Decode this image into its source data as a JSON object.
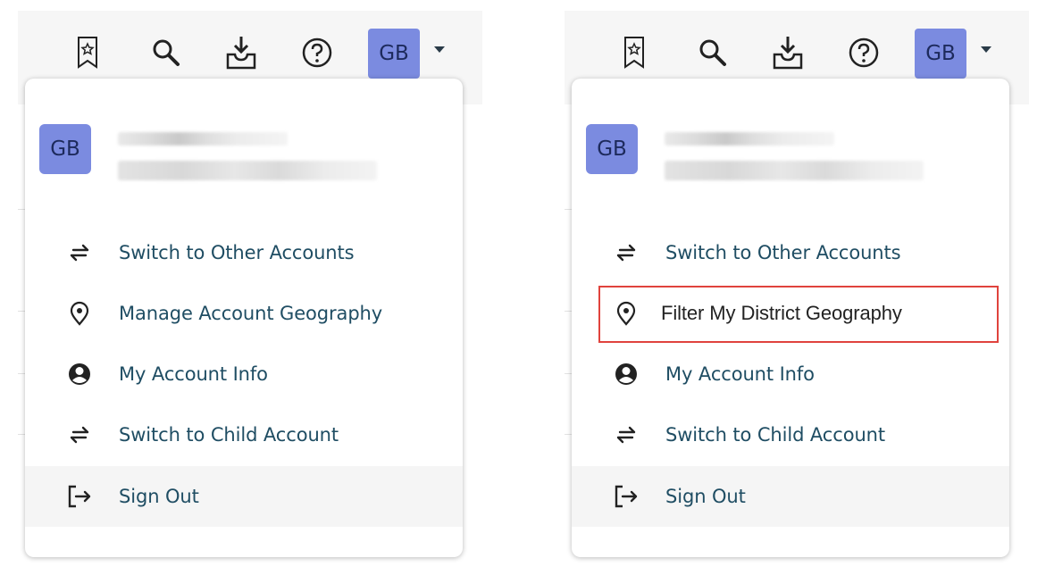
{
  "panels": [
    {
      "avatar_initials": "GB",
      "menu_avatar_initials": "GB",
      "items": [
        {
          "label": "Switch to Other Accounts",
          "icon": "switch-arrows-icon"
        },
        {
          "label": "Manage Account Geography",
          "icon": "location-pin-icon"
        },
        {
          "label": "My Account Info",
          "icon": "user-circle-icon"
        },
        {
          "label": "Switch to Child Account",
          "icon": "switch-arrows-icon"
        },
        {
          "label": "Sign Out",
          "icon": "sign-out-icon"
        }
      ]
    },
    {
      "avatar_initials": "GB",
      "menu_avatar_initials": "GB",
      "items": [
        {
          "label": "Switch to Other Accounts",
          "icon": "switch-arrows-icon"
        },
        {
          "label": "Filter My District Geography",
          "icon": "location-pin-icon",
          "highlighted": true
        },
        {
          "label": "My Account Info",
          "icon": "user-circle-icon"
        },
        {
          "label": "Switch to Child Account",
          "icon": "switch-arrows-icon"
        },
        {
          "label": "Sign Out",
          "icon": "sign-out-icon"
        }
      ]
    }
  ],
  "toolbar_icons": [
    "bookmark-star-icon",
    "search-icon",
    "inbox-download-icon",
    "help-circle-icon"
  ],
  "colors": {
    "avatar_bg": "#7b8be0",
    "menu_text": "#1f4d63",
    "highlight_border": "#e0433d",
    "signout_bg": "#f5f5f5"
  }
}
